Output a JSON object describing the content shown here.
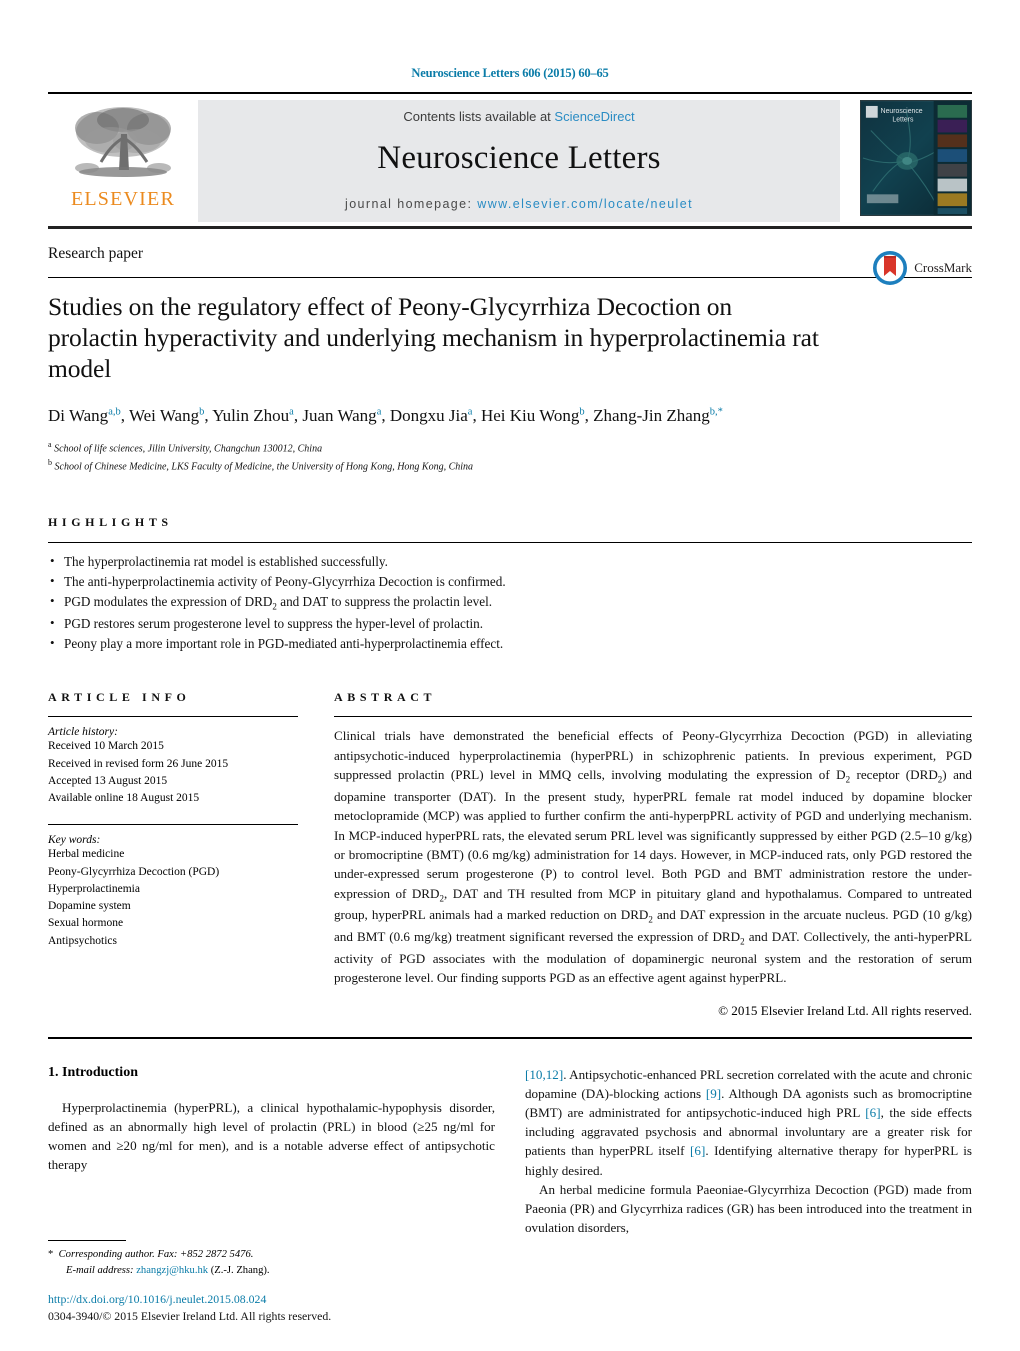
{
  "running_head": "Neuroscience Letters 606 (2015) 60–65",
  "banner": {
    "contents_prefix": "Contents lists available at ",
    "sciencedirect": "ScienceDirect",
    "journal_name": "Neuroscience Letters",
    "homepage_prefix": "journal homepage: ",
    "homepage_url": "www.elsevier.com/locate/neulet",
    "publisher_wordmark": "ELSEVIER",
    "cover_title_line1": "Neuroscience",
    "cover_title_line2": "Letters",
    "colors": {
      "link_blue": "#2a8cc4",
      "head_teal": "#0b7ca8",
      "elsevier_orange": "#eb8a1e",
      "banner_gray": "#e7e8ea"
    }
  },
  "article": {
    "kicker": "Research paper",
    "title": "Studies on the regulatory effect of Peony-Glycyrrhiza Decoction on prolactin hyperactivity and underlying mechanism in hyperprolactinemia rat model",
    "authors": [
      {
        "name": "Di Wang",
        "sup": "a,b",
        "sep": ", "
      },
      {
        "name": "Wei Wang",
        "sup": "b",
        "sep": ", "
      },
      {
        "name": "Yulin Zhou",
        "sup": "a",
        "sep": ", "
      },
      {
        "name": "Juan Wang",
        "sup": "a",
        "sep": ", "
      },
      {
        "name": "Dongxu Jia",
        "sup": "a",
        "sep": ", "
      },
      {
        "name": "Hei Kiu Wong",
        "sup": "b",
        "sep": ", "
      },
      {
        "name": "Zhang-Jin Zhang",
        "sup": "b,*",
        "sep": ""
      }
    ],
    "affiliations": [
      {
        "marker": "a",
        "text": "School of life sciences, Jilin University, Changchun 130012, China"
      },
      {
        "marker": "b",
        "text": "School of Chinese Medicine, LKS Faculty of Medicine, the University of Hong Kong, Hong Kong, China"
      }
    ],
    "crossmark_label": "CrossMark"
  },
  "highlights": {
    "label": "HIGHLIGHTS",
    "items": [
      "The hyperprolactinemia rat model is established successfully.",
      "The anti-hyperprolactinemia activity of Peony-Glycyrrhiza Decoction is confirmed.",
      "PGD modulates the expression of DRD₂ and DAT to suppress the prolactin level.",
      "PGD restores serum progesterone level to suppress the hyper-level of prolactin.",
      "Peony play a more important role in PGD-mediated anti-hyperprolactinemia effect."
    ]
  },
  "article_info": {
    "label": "ARTICLE INFO",
    "history_title": "Article history:",
    "history": [
      "Received 10 March 2015",
      "Received in revised form 26 June 2015",
      "Accepted 13 August 2015",
      "Available online 18 August 2015"
    ],
    "keywords_title": "Key words:",
    "keywords": [
      "Herbal medicine",
      "Peony-Glycyrrhiza Decoction (PGD)",
      "Hyperprolactinemia",
      "Dopamine system",
      "Sexual hormone",
      "Antipsychotics"
    ]
  },
  "abstract": {
    "label": "ABSTRACT",
    "text": "Clinical trials have demonstrated the beneficial effects of Peony-Glycyrrhiza Decoction (PGD) in alleviating antipsychotic-induced hyperprolactinemia (hyperPRL) in schizophrenic patients. In previous experiment, PGD suppressed prolactin (PRL) level in MMQ cells, involving modulating the expression of D₂ receptor (DRD₂) and dopamine transporter (DAT). In the present study, hyperPRL female rat model induced by dopamine blocker metoclopramide (MCP) was applied to further confirm the anti-hyperpPRL activity of PGD and underlying mechanism. In MCP-induced hyperPRL rats, the elevated serum PRL level was significantly suppressed by either PGD (2.5–10 g/kg) or bromocriptine (BMT) (0.6 mg/kg) administration for 14 days. However, in MCP-induced rats, only PGD restored the under-expressed serum progesterone (P) to control level. Both PGD and BMT administration restore the under-expression of DRD₂, DAT and TH resulted from MCP in pituitary gland and hypothalamus. Compared to untreated group, hyperPRL animals had a marked reduction on DRD₂ and DAT expression in the arcuate nucleus. PGD (10 g/kg) and BMT (0.6 mg/kg) treatment significant reversed the expression of DRD₂ and DAT. Collectively, the anti-hyperPRL activity of PGD associates with the modulation of dopaminergic neuronal system and the restoration of serum progesterone level. Our finding supports PGD as an effective agent against hyperPRL.",
    "copyright": "© 2015 Elsevier Ireland Ltd. All rights reserved."
  },
  "body": {
    "section_heading": "1. Introduction",
    "left_paragraph": "Hyperprolactinemia (hyperPRL), a clinical hypothalamic-hypophysis disorder, defined as an abnormally high level of prolactin (PRL) in blood (≥25 ng/ml for women and ≥20 ng/ml for men), and is a notable adverse effect of antipsychotic therapy",
    "right_paragraph_1_ref": "[10,12]",
    "right_paragraph_1_a": ". Antipsychotic-enhanced PRL secretion correlated with the acute and chronic dopamine (DA)-blocking actions ",
    "right_paragraph_1_ref2": "[9]",
    "right_paragraph_1_b": ". Although DA agonists such as bromocriptine (BMT) are administrated for antipsychotic-induced high PRL ",
    "right_paragraph_1_ref3": "[6]",
    "right_paragraph_1_c": ", the side effects including aggravated psychosis and abnormal involuntary are a greater risk for patients than hyperPRL itself ",
    "right_paragraph_1_ref4": "[6]",
    "right_paragraph_1_d": ". Identifying alternative therapy for hyperPRL is highly desired.",
    "right_paragraph_2": "An herbal medicine formula Paeoniae-Glycyrrhiza Decoction (PGD) made from Paeonia (PR) and Glycyrrhiza radices (GR) has been introduced into the treatment in ovulation disorders,"
  },
  "footnote": {
    "star": "*",
    "corresponding": "Corresponding author. Fax: +852 2872 5476.",
    "email_label": "E-mail address:",
    "email": "zhangzj@hku.hk",
    "email_suffix": "(Z.-J. Zhang)."
  },
  "doc_footer": {
    "doi": "http://dx.doi.org/10.1016/j.neulet.2015.08.024",
    "issn_line": "0304-3940/© 2015 Elsevier Ireland Ltd. All rights reserved."
  }
}
